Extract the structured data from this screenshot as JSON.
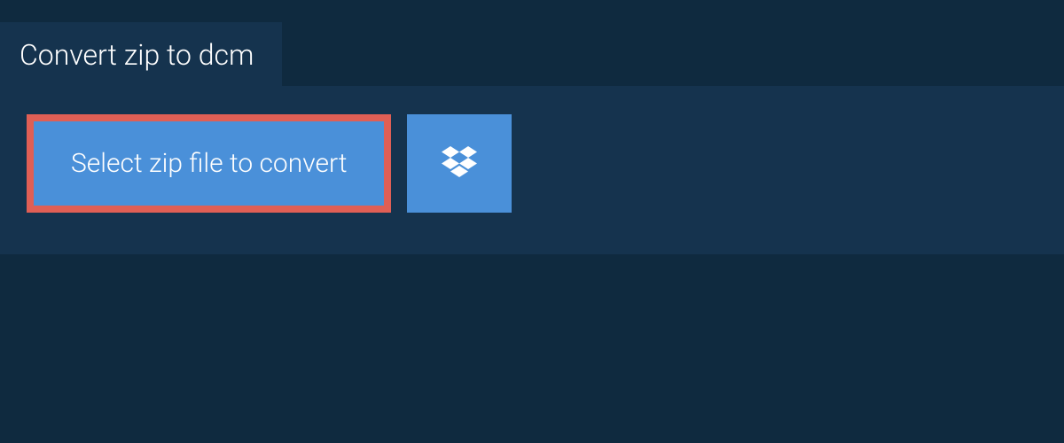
{
  "tab": {
    "title": "Convert zip to dcm"
  },
  "buttons": {
    "select_file_label": "Select zip file to convert"
  },
  "colors": {
    "page_bg": "#0f2a3f",
    "panel_bg": "#15334e",
    "button_bg": "#4a90d9",
    "highlight_border": "#e05f55",
    "text": "#ffffff"
  }
}
